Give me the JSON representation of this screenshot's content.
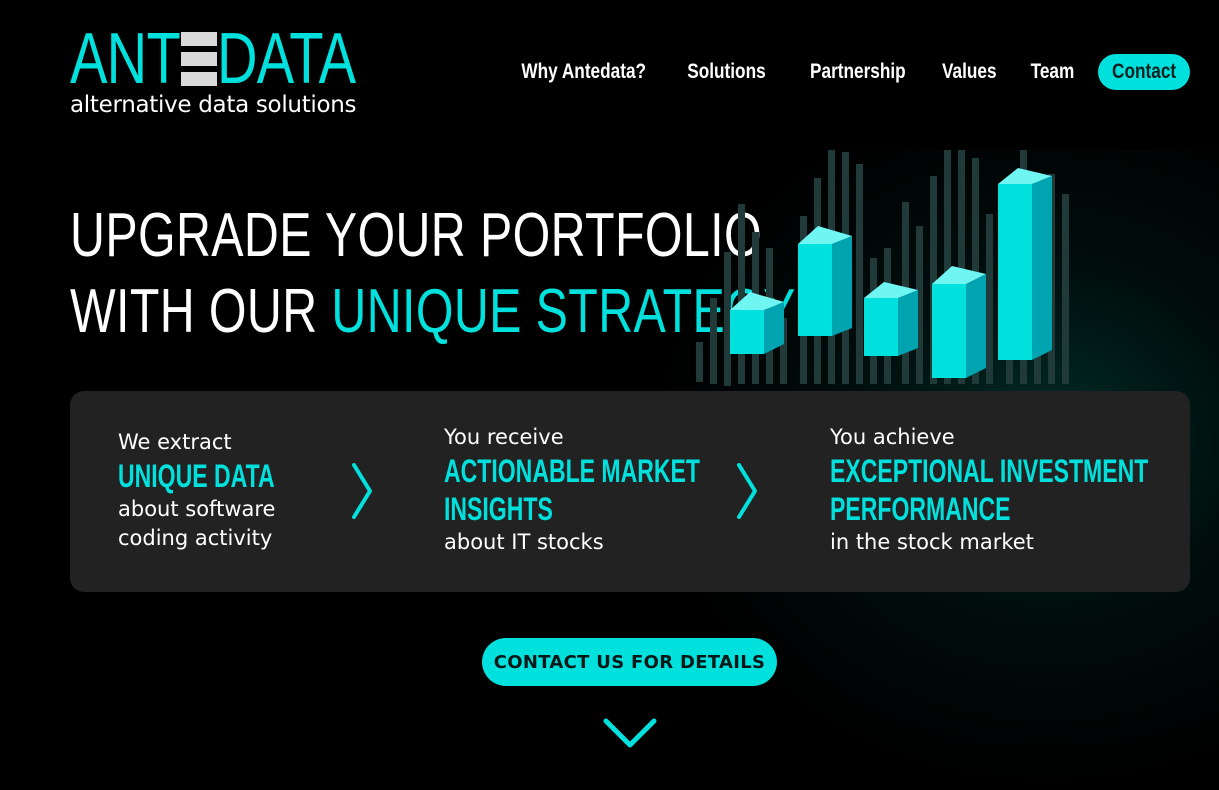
{
  "brand": {
    "logo_left": "ANT",
    "logo_right": "DATA",
    "tagline": "alternative data solutions",
    "accent_color": "#00e0dc"
  },
  "nav": {
    "items": [
      {
        "label": "Why Antedata?"
      },
      {
        "label": "Solutions"
      },
      {
        "label": "Partnership"
      },
      {
        "label": "Values"
      },
      {
        "label": "Team"
      }
    ],
    "contact_label": "Contact"
  },
  "hero": {
    "line1": "UPGRADE YOUR PORTFOLIO",
    "line2_plain": "WITH OUR ",
    "line2_accent": "UNIQUE STRATEGY"
  },
  "steps": [
    {
      "pre": "We extract",
      "highlight": [
        "UNIQUE DATA"
      ],
      "post": [
        "about software",
        "coding activity"
      ]
    },
    {
      "pre": "You receive",
      "highlight": [
        "ACTIONABLE MARKET",
        "INSIGHTS"
      ],
      "post": [
        "about IT stocks"
      ]
    },
    {
      "pre": "You achieve",
      "highlight": [
        "EXCEPTIONAL INVESTMENT",
        "PERFORMANCE"
      ],
      "post": [
        "in the stock market"
      ]
    }
  ],
  "cta": {
    "label": "CONTACT US FOR DETAILS"
  },
  "icons": {
    "step_arrow": "chevron-right-icon",
    "scroll_down": "chevron-down-icon"
  }
}
